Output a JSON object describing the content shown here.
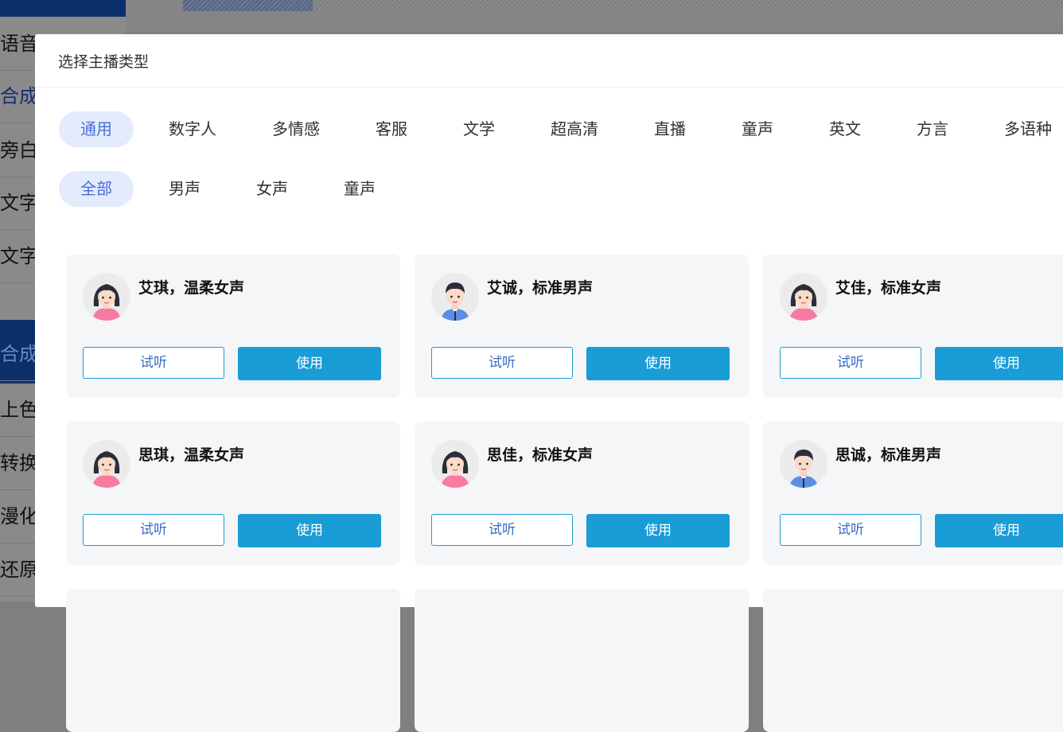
{
  "background": {
    "sidebar_items": [
      {
        "label": "语音"
      },
      {
        "label": "合成"
      },
      {
        "label": "旁白"
      },
      {
        "label": "文字"
      },
      {
        "label": "文字"
      },
      {
        "label": "合成A"
      },
      {
        "label": "上色"
      },
      {
        "label": "转换"
      },
      {
        "label": "漫化"
      },
      {
        "label": "还原"
      }
    ]
  },
  "dialog": {
    "title": "选择主播类型",
    "category_tabs": [
      {
        "label": "通用",
        "active": true
      },
      {
        "label": "数字人"
      },
      {
        "label": "多情感"
      },
      {
        "label": "客服"
      },
      {
        "label": "文学"
      },
      {
        "label": "超高清"
      },
      {
        "label": "直播"
      },
      {
        "label": "童声"
      },
      {
        "label": "英文"
      },
      {
        "label": "方言"
      },
      {
        "label": "多语种"
      }
    ],
    "gender_tabs": [
      {
        "label": "全部",
        "active": true
      },
      {
        "label": "男声"
      },
      {
        "label": "女声"
      },
      {
        "label": "童声"
      }
    ],
    "voices": [
      {
        "name": "艾琪，温柔女声",
        "avatar": "female-avatar-icon",
        "listen": "试听",
        "use": "使用"
      },
      {
        "name": "艾诚，标准男声",
        "avatar": "male-avatar-icon",
        "listen": "试听",
        "use": "使用"
      },
      {
        "name": "艾佳，标准女声",
        "avatar": "female-avatar-icon",
        "listen": "试听",
        "use": "使用"
      },
      {
        "name": "思琪，温柔女声",
        "avatar": "female-avatar-icon",
        "listen": "试听",
        "use": "使用"
      },
      {
        "name": "思佳，标准女声",
        "avatar": "female-avatar-icon",
        "listen": "试听",
        "use": "使用"
      },
      {
        "name": "思诚，标准男声",
        "avatar": "male-avatar-icon",
        "listen": "试听",
        "use": "使用"
      }
    ],
    "colors": {
      "accent": "#1a9cd6",
      "active_tab_bg": "#e3ebfd",
      "active_tab_text": "#4a6fd6"
    }
  }
}
